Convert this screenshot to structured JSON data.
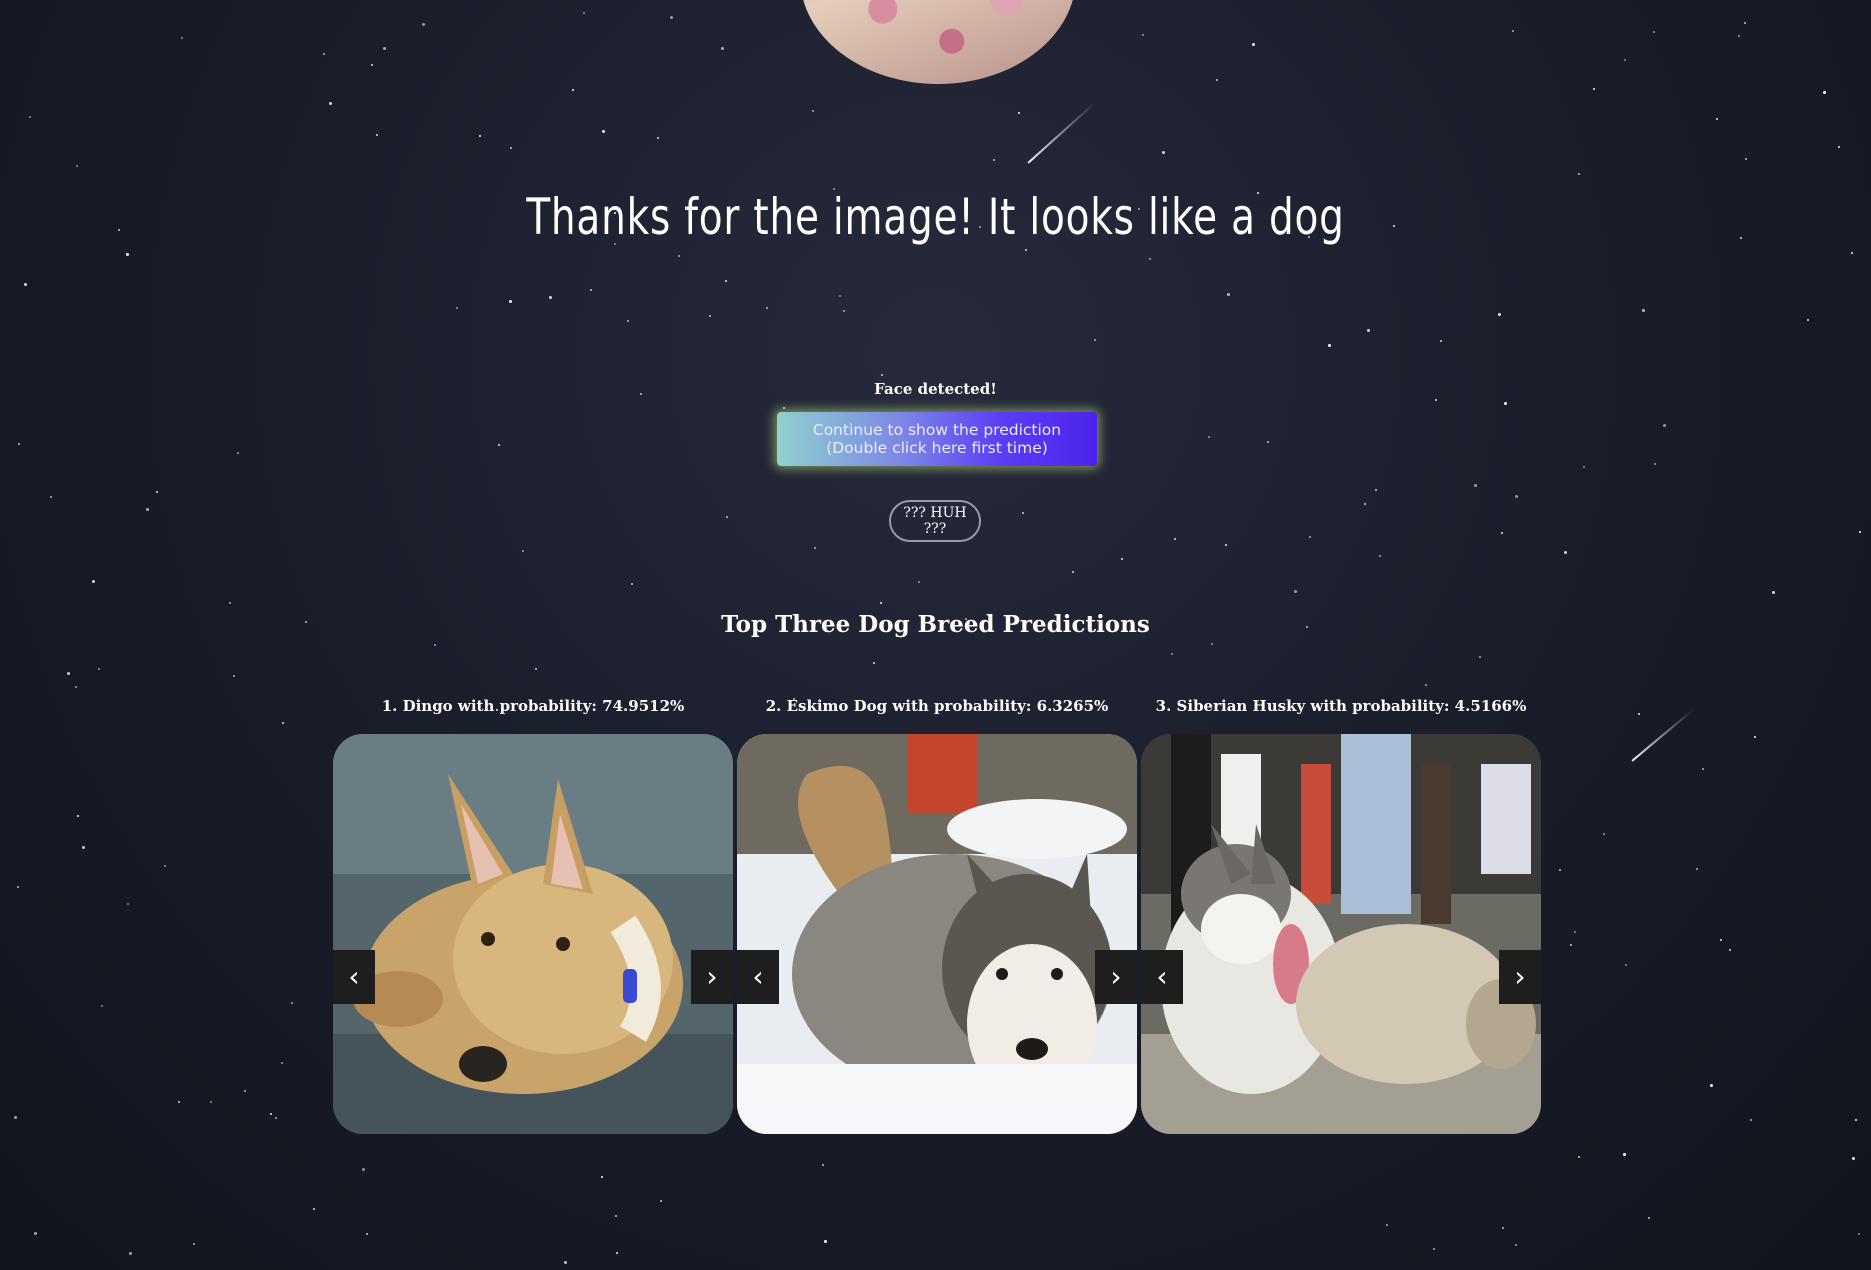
{
  "headline": "Thanks for the image! It looks like a dog",
  "face_status": "Face detected!",
  "continue_button": "Continue to show the prediction (Double click here first time)",
  "huh_button": "??? HUH ???",
  "predictions_title": "Top Three Dog Breed Predictions",
  "predictions": [
    {
      "caption": "1. Dingo with probability: 74.9512%",
      "prev_icon": "‹",
      "next_icon": "›"
    },
    {
      "caption": "2. Eskimo Dog with probability: 6.3265%",
      "prev_icon": "‹",
      "next_icon": "›"
    },
    {
      "caption": "3. Siberian Husky with probability: 4.5166%",
      "prev_icon": "‹",
      "next_icon": "›"
    }
  ],
  "colors": {
    "background": "#1b1e2b",
    "button_gradient_start": "#8fd1cf",
    "button_gradient_end": "#4d23ec",
    "button_glow": "#bee678"
  }
}
